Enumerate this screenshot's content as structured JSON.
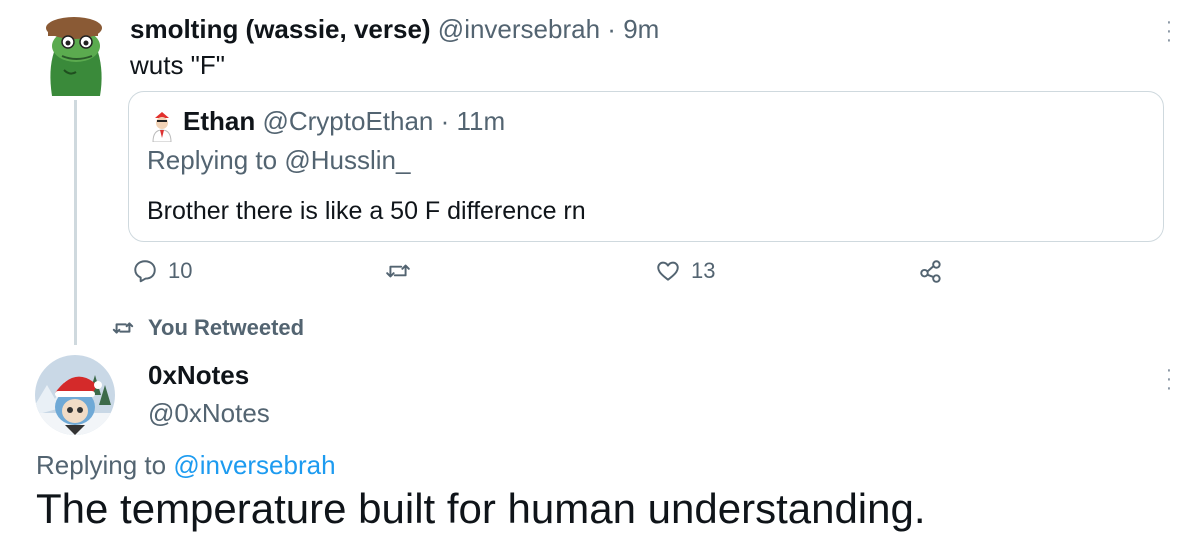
{
  "tweet": {
    "author_name": "smolting (wassie, verse)",
    "author_handle": "@inversebrah",
    "separator": "·",
    "time": "9m",
    "text": "wuts \"F\"",
    "avatar_icon": "pepe-avatar-icon",
    "more_icon": "more-options-icon",
    "quoted": {
      "author_name": "Ethan",
      "author_handle": "@CryptoEthan",
      "separator": "·",
      "time": "11m",
      "replying_prefix": "Replying to ",
      "replying_handle": "@Husslin_",
      "text": "Brother there is like a 50 F difference rn",
      "avatar_icon": "ethan-avatar-icon"
    },
    "actions": {
      "reply_count": "10",
      "retweet_count": "",
      "like_count": "13",
      "icons": [
        "reply-icon",
        "retweet-icon",
        "like-icon",
        "share-icon"
      ]
    }
  },
  "retweet_label": "You Retweeted",
  "reply_tweet": {
    "author_name": "0xNotes",
    "author_handle": "@0xNotes",
    "replying_prefix": "Replying to ",
    "replying_handle": "@inversebrah",
    "text": "The temperature built for human understanding.",
    "avatar_icon": "santa-hat-avatar-icon",
    "more_icon": "more-options-icon"
  },
  "colors": {
    "text": "#0f1419",
    "muted": "#536471",
    "link": "#1d9bf0",
    "border": "#cfd9de"
  }
}
